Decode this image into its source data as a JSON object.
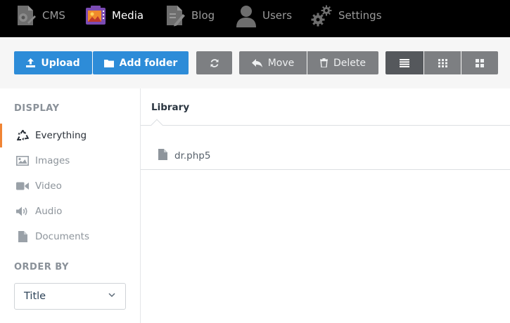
{
  "nav": {
    "items": [
      {
        "label": "CMS",
        "icon": "cms-icon"
      },
      {
        "label": "Media",
        "icon": "media-icon"
      },
      {
        "label": "Blog",
        "icon": "blog-icon"
      },
      {
        "label": "Users",
        "icon": "user-icon"
      },
      {
        "label": "Settings",
        "icon": "settings-gears-icon"
      }
    ],
    "active": "Media"
  },
  "toolbar": {
    "upload_label": "Upload",
    "add_folder_label": "Add folder",
    "move_label": "Move",
    "delete_label": "Delete",
    "refresh_icon": "refresh-icon",
    "view_icons": [
      "list-view-icon",
      "grid-small-view-icon",
      "grid-large-view-icon"
    ]
  },
  "sidebar": {
    "display_heading": "DISPLAY",
    "items": [
      {
        "label": "Everything",
        "icon": "recycle-icon",
        "active": true
      },
      {
        "label": "Images",
        "icon": "image-icon",
        "active": false
      },
      {
        "label": "Video",
        "icon": "video-icon",
        "active": false
      },
      {
        "label": "Audio",
        "icon": "audio-icon",
        "active": false
      },
      {
        "label": "Documents",
        "icon": "document-icon",
        "active": false
      }
    ],
    "order_heading": "ORDER BY",
    "order_value": "Title"
  },
  "main": {
    "title": "Library",
    "files": [
      {
        "name": "dr.php5",
        "icon": "file-icon"
      }
    ]
  },
  "colors": {
    "accent_blue": "#2d8cd8",
    "active_marker": "#f08434",
    "media_icon": "#7b4bb3"
  }
}
